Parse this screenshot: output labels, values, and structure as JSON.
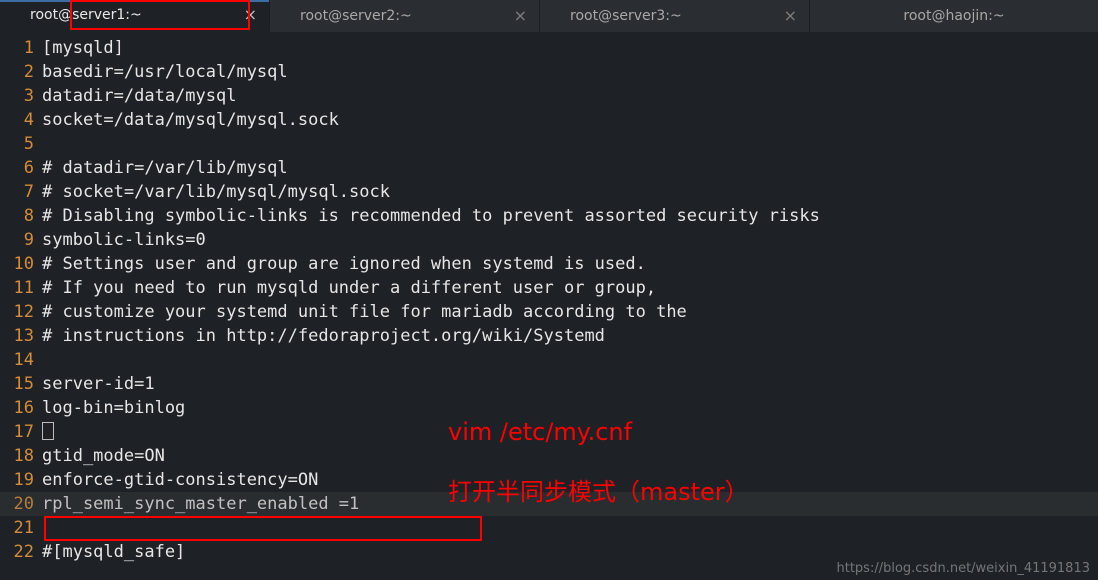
{
  "tabs": [
    {
      "label": "root@server1:~",
      "active": true
    },
    {
      "label": "root@server2:~",
      "active": false
    },
    {
      "label": "root@server3:~",
      "active": false
    },
    {
      "label": "root@haojin:~",
      "active": false
    }
  ],
  "code_lines": [
    "[mysqld]",
    "basedir=/usr/local/mysql",
    "datadir=/data/mysql",
    "socket=/data/mysql/mysql.sock",
    "",
    "# datadir=/var/lib/mysql",
    "# socket=/var/lib/mysql/mysql.sock",
    "# Disabling symbolic-links is recommended to prevent assorted security risks",
    "symbolic-links=0",
    "# Settings user and group are ignored when systemd is used.",
    "# If you need to run mysqld under a different user or group,",
    "# customize your systemd unit file for mariadb according to the",
    "# instructions in http://fedoraproject.org/wiki/Systemd",
    "",
    "server-id=1",
    "log-bin=binlog",
    "CURSOR",
    "gtid_mode=ON",
    "enforce-gtid-consistency=ON",
    "rpl_semi_sync_master_enabled =1",
    "",
    "#[mysqld_safe]"
  ],
  "annotations": {
    "line1": "vim /etc/my.cnf",
    "line2": "打开半同步模式（master）"
  },
  "watermark": "https://blog.csdn.net/weixin_41191813"
}
